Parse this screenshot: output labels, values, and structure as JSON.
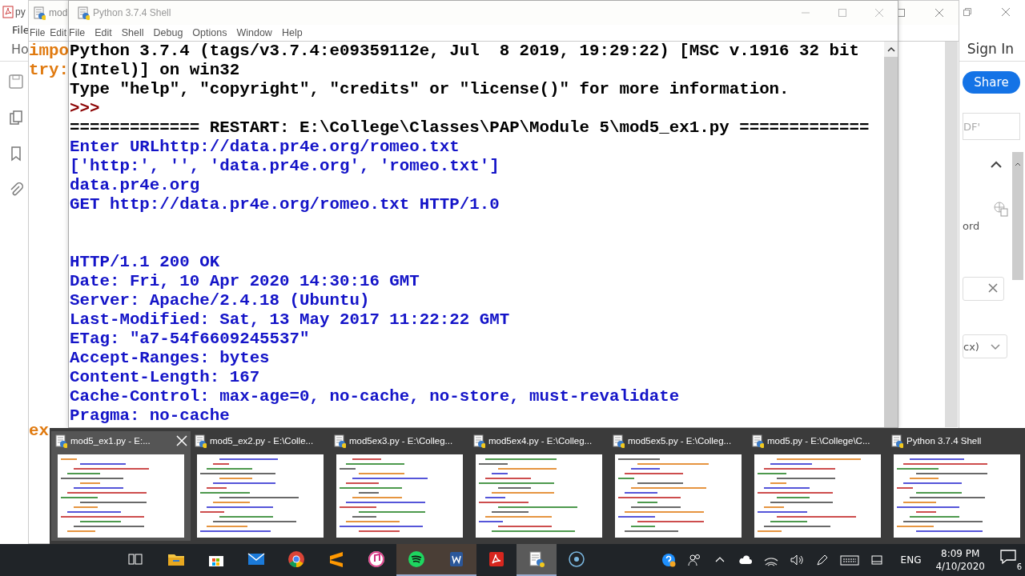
{
  "acrobat": {
    "title": "py",
    "menu": [
      "File"
    ],
    "tab": "Ho",
    "sign_in": "Sign In",
    "share": "Share",
    "field_text": "DF'",
    "option_text": "ord",
    "dropdown_text": "cx)"
  },
  "editor": {
    "title": "mod",
    "menu": [
      "File",
      "Edit"
    ],
    "code": [
      "impo",
      "try:"
    ],
    "bottom_code": "ex"
  },
  "shell": {
    "title": "Python 3.7.4 Shell",
    "menu": [
      "File",
      "Edit",
      "Shell",
      "Debug",
      "Options",
      "Window",
      "Help"
    ],
    "lines": [
      {
        "kind": "plain",
        "text": "Python 3.7.4 (tags/v3.7.4:e09359112e, Jul  8 2019, 19:29:22) [MSC v.1916 32 bit"
      },
      {
        "kind": "plain",
        "text": "(Intel)] on win32"
      },
      {
        "kind": "plain",
        "text": "Type \"help\", \"copyright\", \"credits\" or \"license()\" for more information."
      },
      {
        "kind": "prompt",
        "text": ">>>"
      },
      {
        "kind": "plain",
        "text": "============= RESTART: E:\\College\\Classes\\PAP\\Module 5\\mod5_ex1.py ============="
      },
      {
        "kind": "stdout",
        "text": "Enter URLhttp://data.pr4e.org/romeo.txt"
      },
      {
        "kind": "stdout",
        "text": "['http:', '', 'data.pr4e.org', 'romeo.txt']"
      },
      {
        "kind": "stdout",
        "text": "data.pr4e.org"
      },
      {
        "kind": "stdout",
        "text": "GET http://data.pr4e.org/romeo.txt HTTP/1.0"
      },
      {
        "kind": "blank"
      },
      {
        "kind": "blank"
      },
      {
        "kind": "stdout",
        "text": "HTTP/1.1 200 OK"
      },
      {
        "kind": "stdout",
        "text": "Date: Fri, 10 Apr 2020 14:30:16 GMT"
      },
      {
        "kind": "stdout",
        "text": "Server: Apache/2.4.18 (Ubuntu)"
      },
      {
        "kind": "stdout",
        "text": "Last-Modified: Sat, 13 May 2017 11:22:22 GMT"
      },
      {
        "kind": "stdout",
        "text": "ETag: \"a7-54f6609245537\""
      },
      {
        "kind": "stdout",
        "text": "Accept-Ranges: bytes"
      },
      {
        "kind": "stdout",
        "text": "Content-Length: 167"
      },
      {
        "kind": "stdout",
        "text": "Cache-Control: max-age=0, no-cache, no-store, must-revalidate"
      },
      {
        "kind": "stdout",
        "text": "Pragma: no-cache"
      }
    ]
  },
  "thumbnails": [
    {
      "title": "mod5_ex1.py - E:...",
      "selected": true
    },
    {
      "title": "mod5_ex2.py - E:\\Colle...",
      "selected": false
    },
    {
      "title": "mod5ex3.py - E:\\Colleg...",
      "selected": false
    },
    {
      "title": "mod5ex4.py - E:\\Colleg...",
      "selected": false
    },
    {
      "title": "mod5ex5.py - E:\\Colleg...",
      "selected": false
    },
    {
      "title": "mod5.py - E:\\College\\C...",
      "selected": false
    },
    {
      "title": "Python 3.7.4 Shell",
      "selected": false
    }
  ],
  "taskbar": {
    "apps": [
      {
        "kind": "taskview",
        "running": false
      },
      {
        "kind": "explorer",
        "running": false
      },
      {
        "kind": "store",
        "running": false
      },
      {
        "kind": "mail",
        "running": false
      },
      {
        "kind": "chrome",
        "running": false
      },
      {
        "kind": "sublime",
        "running": false
      },
      {
        "kind": "itunes",
        "running": false
      },
      {
        "kind": "spotify",
        "running": true
      },
      {
        "kind": "word",
        "running": true
      },
      {
        "kind": "acrobat",
        "running": false
      },
      {
        "kind": "idle",
        "running": true
      },
      {
        "kind": "circle",
        "running": false
      }
    ],
    "language": "ENG",
    "time": "8:09 PM",
    "date": "4/10/2020",
    "notifications": "6"
  }
}
